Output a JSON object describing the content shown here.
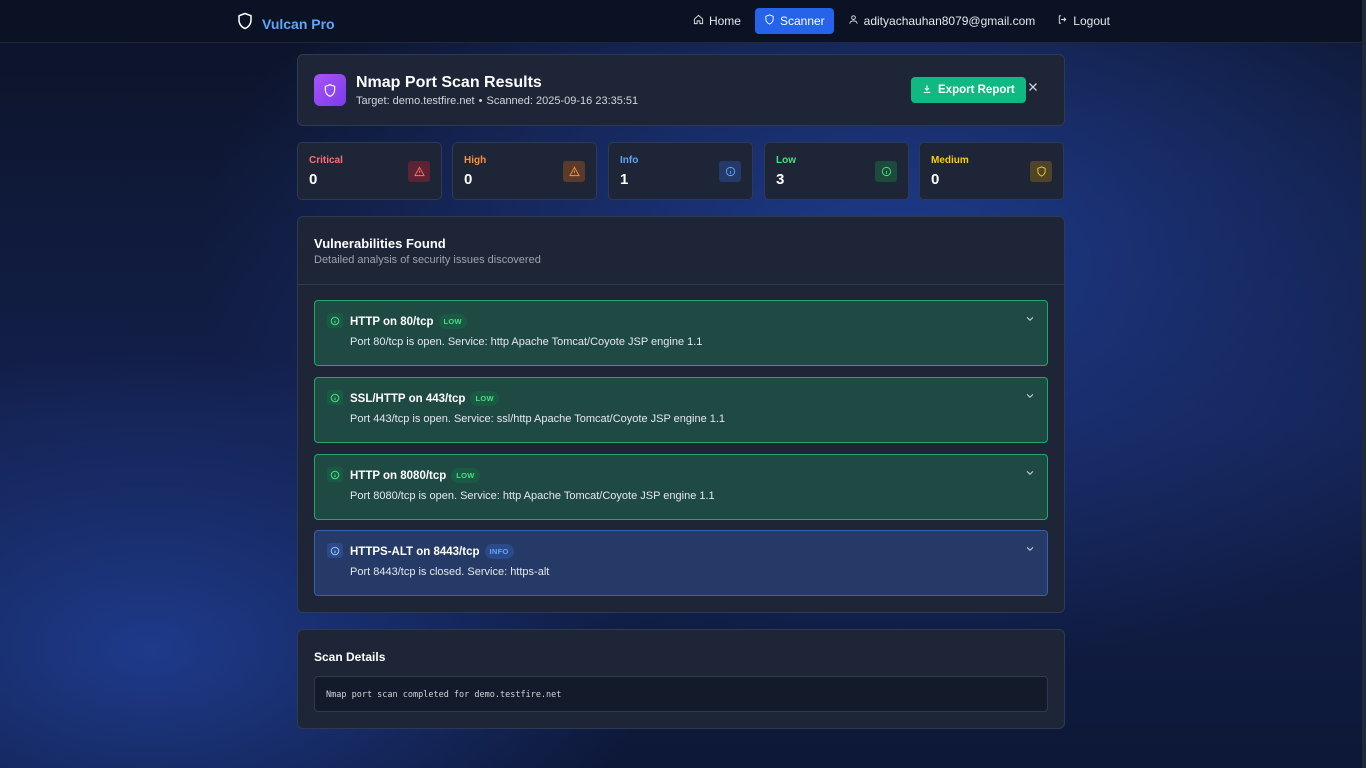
{
  "nav": {
    "brand": "Vulcan Pro",
    "home": "Home",
    "scanner": "Scanner",
    "user_email": "adityachauhan8079@gmail.com",
    "logout": "Logout"
  },
  "header": {
    "title": "Nmap Port Scan Results",
    "target": "Target: demo.testfire.net",
    "separator": "•",
    "scanned": "Scanned: 2025-09-16 23:35:51",
    "export_label": "Export Report"
  },
  "stats": [
    {
      "label": "Critical",
      "value": "0",
      "color": "#f87171"
    },
    {
      "label": "High",
      "value": "0",
      "color": "#fb923c"
    },
    {
      "label": "Info",
      "value": "1",
      "color": "#60a5fa"
    },
    {
      "label": "Low",
      "value": "3",
      "color": "#4ade80"
    },
    {
      "label": "Medium",
      "value": "0",
      "color": "#facc15"
    }
  ],
  "vulnerabilities": {
    "title": "Vulnerabilities Found",
    "subtitle": "Detailed analysis of security issues discovered",
    "items": [
      {
        "name": "HTTP on 80/tcp",
        "severity": "LOW",
        "description": "Port 80/tcp is open. Service: http Apache Tomcat/Coyote JSP engine 1.1"
      },
      {
        "name": "SSL/HTTP on 443/tcp",
        "severity": "LOW",
        "description": "Port 443/tcp is open. Service: ssl/http Apache Tomcat/Coyote JSP engine 1.1"
      },
      {
        "name": "HTTP on 8080/tcp",
        "severity": "LOW",
        "description": "Port 8080/tcp is open. Service: http Apache Tomcat/Coyote JSP engine 1.1"
      },
      {
        "name": "HTTPS-ALT on 8443/tcp",
        "severity": "INFO",
        "description": "Port 8443/tcp is closed. Service: https-alt"
      }
    ]
  },
  "details": {
    "title": "Scan Details",
    "text": "Nmap port scan completed for demo.testfire.net"
  }
}
